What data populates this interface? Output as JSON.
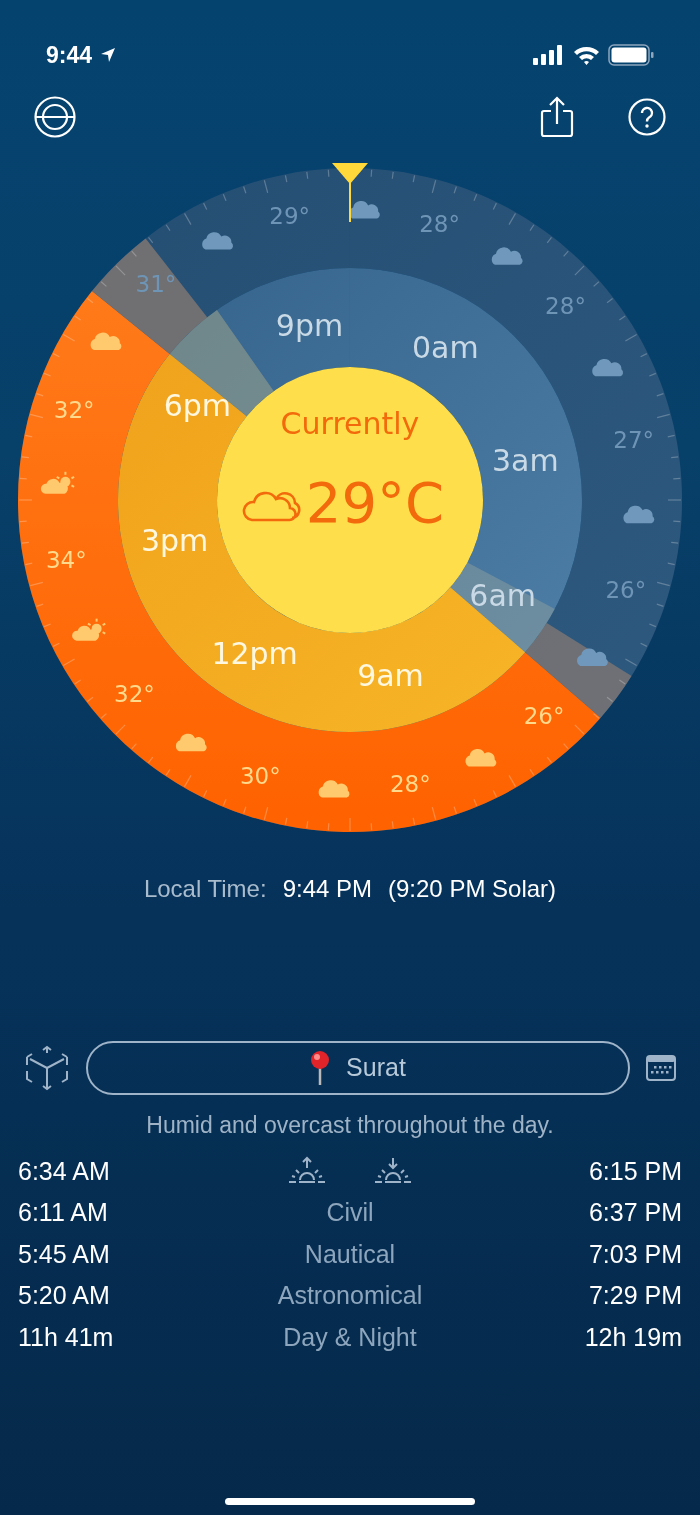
{
  "status_bar": {
    "time": "9:44"
  },
  "dial": {
    "current_label": "Currently",
    "current_temp": "29°C",
    "hour_labels": [
      "9pm",
      "0am",
      "3am",
      "6am",
      "9am",
      "12pm",
      "3pm",
      "6pm"
    ],
    "outer": [
      {
        "kind": "cloud"
      },
      {
        "kind": "temp",
        "text": "28°"
      },
      {
        "kind": "cloud"
      },
      {
        "kind": "temp",
        "text": "28°"
      },
      {
        "kind": "cloud"
      },
      {
        "kind": "temp",
        "text": "27°"
      },
      {
        "kind": "cloud"
      },
      {
        "kind": "temp",
        "text": "26°"
      },
      {
        "kind": "cloud"
      },
      {
        "kind": "temp",
        "text": "26°"
      },
      {
        "kind": "cloud"
      },
      {
        "kind": "temp",
        "text": "28°"
      },
      {
        "kind": "cloud"
      },
      {
        "kind": "temp",
        "text": "30°"
      },
      {
        "kind": "cloud"
      },
      {
        "kind": "temp",
        "text": "32°"
      },
      {
        "kind": "sun-cloud"
      },
      {
        "kind": "temp",
        "text": "34°"
      },
      {
        "kind": "sun-cloud"
      },
      {
        "kind": "temp",
        "text": "32°"
      },
      {
        "kind": "cloud"
      },
      {
        "kind": "temp",
        "text": "31°"
      },
      {
        "kind": "cloud"
      },
      {
        "kind": "temp",
        "text": "29°"
      }
    ]
  },
  "local_time": {
    "label": "Local Time:",
    "value": "9:44 PM",
    "solar": "(9:20 PM Solar)"
  },
  "location": "Surat",
  "description": "Humid and overcast throughout the day.",
  "sun_times": [
    {
      "kind": "icons",
      "morning": "6:34 AM",
      "evening": "6:15 PM"
    },
    {
      "kind": "text",
      "label": "Civil",
      "morning": "6:11 AM",
      "evening": "6:37 PM"
    },
    {
      "kind": "text",
      "label": "Nautical",
      "morning": "5:45 AM",
      "evening": "7:03 PM"
    },
    {
      "kind": "text",
      "label": "Astronomical",
      "morning": "5:20 AM",
      "evening": "7:29 PM"
    },
    {
      "kind": "text",
      "label": "Day & Night",
      "morning": "11h 41m",
      "evening": "12h 19m"
    }
  ]
}
